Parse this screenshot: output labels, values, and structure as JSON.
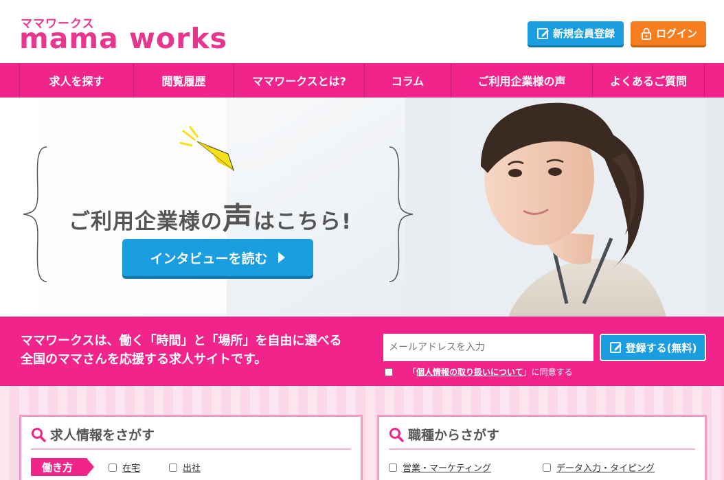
{
  "header": {
    "logo_kana": "ママワークス",
    "logo_text": "mama works",
    "signup_label": "新規会員登録",
    "login_label": "ログイン"
  },
  "nav": {
    "items": [
      {
        "label": "求人を探す"
      },
      {
        "label": "閲覧履歴"
      },
      {
        "label": "ママワークスとは?"
      },
      {
        "label": "コラム"
      },
      {
        "label": "ご利用企業様の声"
      },
      {
        "label": "よくあるご質問"
      }
    ]
  },
  "hero": {
    "headline_pre": "ご利用企業様の",
    "headline_big": "声",
    "headline_post": "はこちら!",
    "cta_label": "インタビューを読む"
  },
  "band": {
    "line1": "ママワークスは、働く「時間」と「場所」を自由に選べる",
    "line2": "全国のママさんを応援する求人サイトです。",
    "email_placeholder": "メールアドレスを入力",
    "register_label": "登録する(無料)",
    "privacy_prefix": "「",
    "privacy_link": "個人情報の取り扱いについて",
    "privacy_suffix": "」に同意する"
  },
  "search_jobs": {
    "title": "求人情報をさがす",
    "tag": "働き方",
    "options": [
      {
        "label": "在宅"
      },
      {
        "label": "出社"
      }
    ]
  },
  "search_category": {
    "title": "職種からさがす",
    "options": [
      {
        "label": "営業・マーケティング"
      },
      {
        "label": "データ入力・タイピング"
      }
    ]
  },
  "colors": {
    "brand_pink": "#f0248a",
    "accent_blue": "#1a9ee0",
    "accent_orange": "#f47e20"
  }
}
